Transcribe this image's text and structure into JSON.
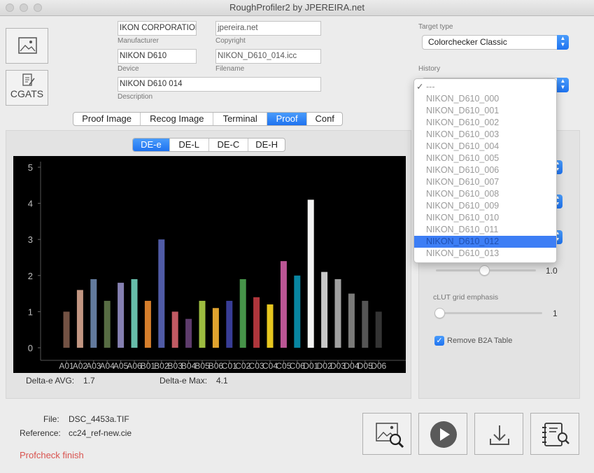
{
  "window": {
    "title": "RoughProfiler2 by JPEREIRA.net"
  },
  "left_buttons": {
    "cgats_label": "CGATS"
  },
  "fields": {
    "manufacturer": {
      "value": "IKON CORPORATION",
      "caption": "Manufacturer"
    },
    "copyright": {
      "value": "jpereira.net",
      "caption": "Copyright"
    },
    "device": {
      "value": "NIKON D610",
      "caption": "Device"
    },
    "filename": {
      "value": "NIKON_D610_014.icc",
      "caption": "Filename"
    },
    "description": {
      "value": "NIKON D610  014",
      "caption": "Description"
    }
  },
  "target_type": {
    "caption": "Target type",
    "value": "Colorchecker Classic"
  },
  "history": {
    "caption": "History",
    "items": [
      "---",
      "NIKON_D610_000",
      "NIKON_D610_001",
      "NIKON_D610_002",
      "NIKON_D610_003",
      "NIKON_D610_004",
      "NIKON_D610_005",
      "NIKON_D610_006",
      "NIKON_D610_007",
      "NIKON_D610_008",
      "NIKON_D610_009",
      "NIKON_D610_010",
      "NIKON_D610_011",
      "NIKON_D610_012",
      "NIKON_D610_013"
    ],
    "checked_index": 0,
    "highlighted_index": 13,
    "check_mark": "✓"
  },
  "main_tabs": [
    "Proof Image",
    "Recog Image",
    "Terminal",
    "Proof",
    "Conf"
  ],
  "main_tabs_active": 3,
  "chart_tabs": [
    "DE-e",
    "DE-L",
    "DE-C",
    "DE-H"
  ],
  "chart_tabs_active": 0,
  "chart_data": {
    "type": "bar",
    "categories": [
      "A01",
      "A02",
      "A03",
      "A04",
      "A05",
      "A06",
      "B01",
      "B02",
      "B03",
      "B04",
      "B05",
      "B06",
      "C01",
      "C02",
      "C03",
      "C04",
      "C05",
      "C06",
      "D01",
      "D02",
      "D03",
      "D04",
      "D05",
      "D06"
    ],
    "values": [
      1.0,
      1.6,
      1.9,
      1.3,
      1.8,
      1.9,
      1.3,
      3.0,
      1.0,
      0.8,
      1.3,
      1.1,
      1.3,
      1.9,
      1.4,
      1.2,
      2.4,
      2.0,
      4.1,
      2.1,
      1.9,
      1.5,
      1.3,
      1.0
    ],
    "colors": [
      "#735244",
      "#c29682",
      "#627a9d",
      "#576c43",
      "#8580b1",
      "#67bdaa",
      "#d67e2c",
      "#505ba6",
      "#c15a63",
      "#5e3c6c",
      "#9dbc40",
      "#e0a32e",
      "#383d96",
      "#469449",
      "#af363c",
      "#e7c71f",
      "#bb5695",
      "#0885a1",
      "#f3f3f2",
      "#c8c8c8",
      "#a0a0a0",
      "#7a7a79",
      "#555555",
      "#343434"
    ],
    "ylim": [
      0,
      5
    ],
    "yticks": [
      "0",
      "1",
      "2",
      "3",
      "4",
      "5"
    ],
    "background": "#000000",
    "grid": false
  },
  "stats": {
    "avg_label": "Delta-e AVG:",
    "avg_value": "1.7",
    "max_label": "Delta-e Max:",
    "max_value": "4.1"
  },
  "right_panel": {
    "slider1_value": "1.0",
    "slider1_level": 0.48,
    "clut_label": "cLUT grid emphasis",
    "slider2_value": "1",
    "slider2_level": 0.0,
    "remove_b2a_label": "Remove B2A Table",
    "remove_b2a_checked": true
  },
  "info": {
    "file_label": "File:",
    "file_value": "DSC_4453a.TIF",
    "reference_label": "Reference:",
    "reference_value": "cc24_ref-new.cie",
    "status": "Profcheck finish",
    "status_color": "#d9534f"
  }
}
